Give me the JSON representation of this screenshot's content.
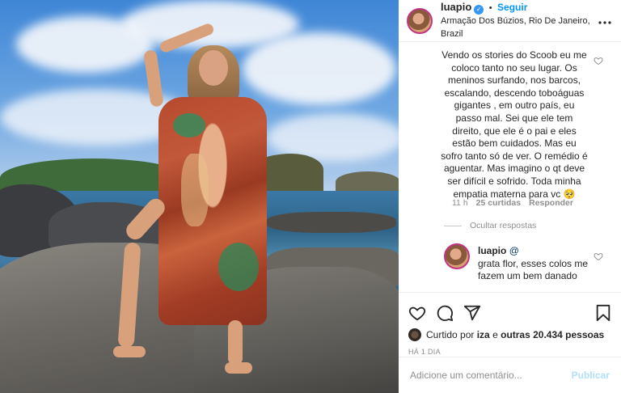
{
  "header": {
    "username": "luapio",
    "verified_mark": "✓",
    "separator": "•",
    "follow_label": "Seguir",
    "location": "Armação Dos Búzios, Rio De Janeiro, Brazil",
    "more_icon": "more-horizontal-icon"
  },
  "comment": {
    "text": "Vendo os stories do Scoob eu me coloco tanto no seu lugar. Os meninos surfando, nos barcos, escalando, descendo toboáguas gigantes , em outro país, eu passo mal. Sei que ele tem direito, que ele é o pai e eles estão bem cuidados. Mas eu sofro tanto só de ver. O remédio é aguentar. Mas imagino o qt deve ser difícil e sofrido. Toda minha empatia materna para vc 🥺",
    "time": "11 h",
    "likes": "25 curtidas",
    "reply_label": "Responder",
    "hide_replies": "Ocultar respostas"
  },
  "reply": {
    "username": "luapio",
    "mention": "@",
    "text": "grata flor, esses colos me fazem um bem danado"
  },
  "actions": {
    "icons": [
      "heart-icon",
      "comment-icon",
      "share-icon",
      "bookmark-icon"
    ],
    "liked_prefix": "Curtido por",
    "liked_user": "iza",
    "liked_connector": "e",
    "liked_others": "outras 20.434 pessoas",
    "timestamp": "HÁ 1 DIA"
  },
  "add_comment": {
    "placeholder": "Adicione um comentário...",
    "publish_label": "Publicar"
  },
  "colors": {
    "accent": "#0095f6",
    "publish_disabled": "#b2dffc",
    "muted": "#8e8e8e"
  }
}
